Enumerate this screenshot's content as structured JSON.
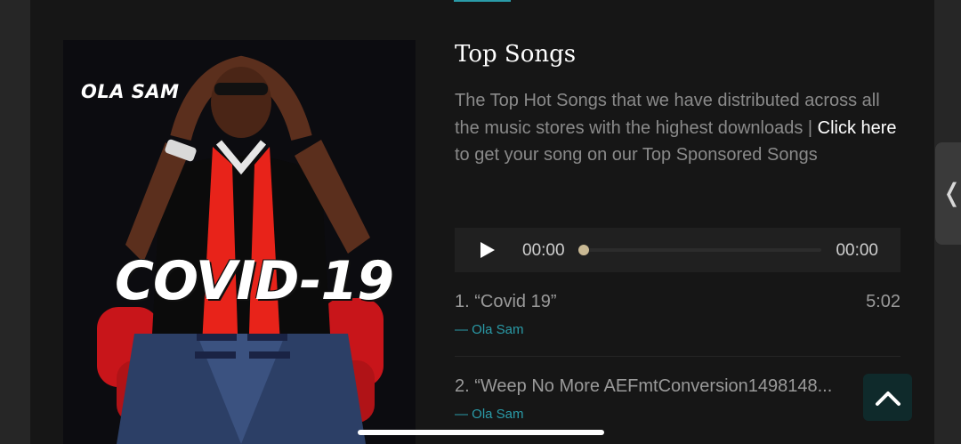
{
  "album_art": {
    "artist_text": "OLA SAM",
    "title_text": "COVID-19"
  },
  "section": {
    "heading": "Top Songs",
    "description_before": "The Top Hot Songs that we have distributed across all the music stores with the highest downloads | ",
    "link_text": "Click here",
    "description_after": " to get your song on our Top Sponsored Songs"
  },
  "player": {
    "current_time": "00:00",
    "duration": "00:00",
    "progress": 0,
    "play_icon": "play-icon"
  },
  "songs": [
    {
      "title": "1. “Covid 19”",
      "length": "5:02",
      "artist": "— Ola Sam"
    },
    {
      "title": "2. “Weep No More AEFmtConversion1498148...",
      "length": "",
      "artist": "— Ola Sam"
    }
  ],
  "colors": {
    "accent": "#2a9ba8",
    "background": "#161616",
    "scarf": "#e8231a"
  },
  "icons": {
    "side_tab": "chevron-left-icon",
    "back_to_top": "chevron-up-icon"
  }
}
